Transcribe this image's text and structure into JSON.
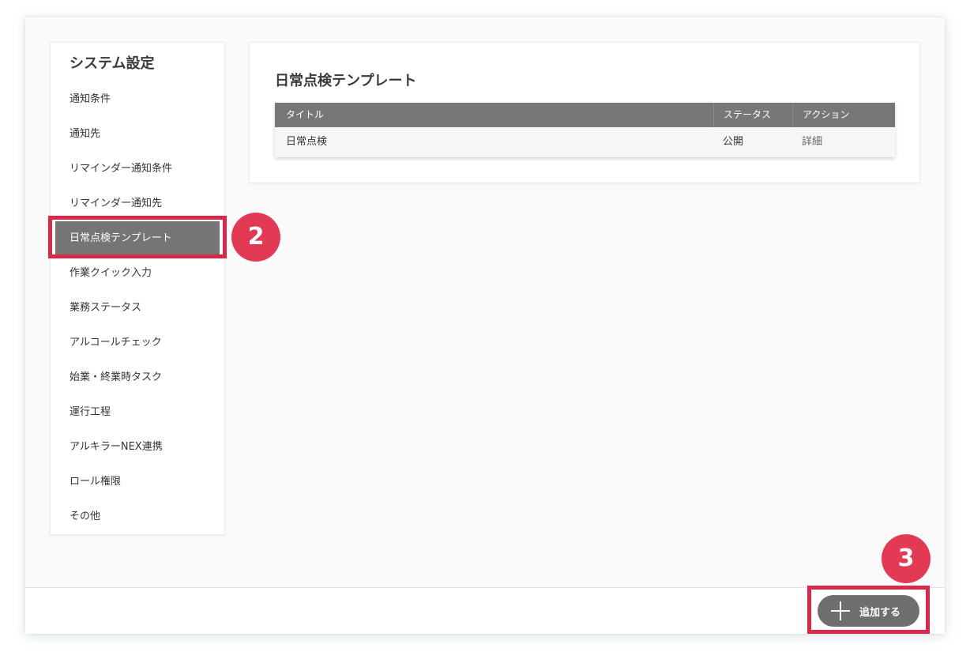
{
  "sidebar": {
    "title": "システム設定",
    "items": [
      {
        "label": "通知条件"
      },
      {
        "label": "通知先"
      },
      {
        "label": "リマインダー通知条件"
      },
      {
        "label": "リマインダー通知先"
      },
      {
        "label": "日常点検テンプレート",
        "active": true
      },
      {
        "label": "作業クイック入力"
      },
      {
        "label": "業務ステータス"
      },
      {
        "label": "アルコールチェック"
      },
      {
        "label": "始業・終業時タスク"
      },
      {
        "label": "運行工程"
      },
      {
        "label": "アルキラーNEX連携"
      },
      {
        "label": "ロール権限"
      },
      {
        "label": "その他"
      }
    ]
  },
  "main": {
    "title": "日常点検テンプレート",
    "table": {
      "headers": [
        "タイトル",
        "ステータス",
        "アクション"
      ],
      "rows": [
        {
          "title": "日常点検",
          "status": "公開",
          "action": "詳細"
        }
      ]
    }
  },
  "footer": {
    "add_label": "追加する"
  },
  "annotations": {
    "step_sidebar": "2",
    "step_add": "3",
    "highlight_color": "#d8294a",
    "badge_color": "#e23a55"
  },
  "colors": {
    "active_item_bg": "#757575",
    "table_header_bg": "#777777",
    "add_button_bg": "#6e6e6e"
  },
  "icons": {
    "add": "plus-icon"
  }
}
